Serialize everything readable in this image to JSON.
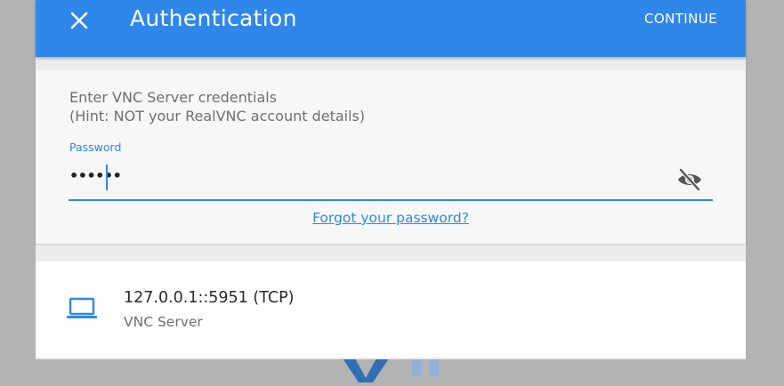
{
  "appbar": {
    "close_icon": "close-icon",
    "title": "Authentication",
    "continue_label": "CONTINUE"
  },
  "credentials": {
    "hint_line1": "Enter VNC Server credentials",
    "hint_line2": "(Hint: NOT your RealVNC account details)",
    "password_label": "Password",
    "password_value": "••••••",
    "visibility_icon": "eye-off-icon",
    "forgot_link": "Forgot your password?"
  },
  "server": {
    "icon": "laptop-icon",
    "address": "127.0.0.1::5951 (TCP)",
    "type": "VNC Server"
  },
  "colors": {
    "accent": "#2f87e9",
    "backdrop": "#b3b3b3"
  }
}
